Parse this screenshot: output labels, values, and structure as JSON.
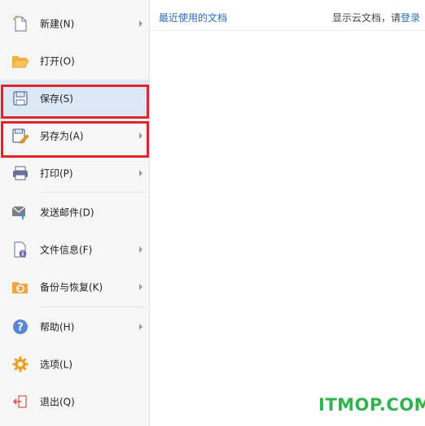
{
  "menu": {
    "items": [
      {
        "id": "new",
        "label": "新建(N)",
        "icon": "new-document-icon",
        "has_submenu": true
      },
      {
        "id": "open",
        "label": "打开(O)",
        "icon": "folder-open-icon",
        "has_submenu": false
      },
      {
        "id": "save",
        "label": "保存(S)",
        "icon": "save-icon",
        "has_submenu": false,
        "active": true
      },
      {
        "id": "save-as",
        "label": "另存为(A)",
        "icon": "save-as-icon",
        "has_submenu": true
      },
      {
        "id": "print",
        "label": "打印(P)",
        "icon": "printer-icon",
        "has_submenu": true
      },
      {
        "id": "send-email",
        "label": "发送邮件(D)",
        "icon": "email-icon",
        "has_submenu": false
      },
      {
        "id": "file-info",
        "label": "文件信息(F)",
        "icon": "file-info-icon",
        "has_submenu": true
      },
      {
        "id": "backup",
        "label": "备份与恢复(K)",
        "icon": "backup-restore-icon",
        "has_submenu": true
      },
      {
        "id": "help",
        "label": "帮助(H)",
        "icon": "help-icon",
        "has_submenu": true
      },
      {
        "id": "options",
        "label": "选项(L)",
        "icon": "gear-icon",
        "has_submenu": false
      },
      {
        "id": "exit",
        "label": "退出(Q)",
        "icon": "exit-icon",
        "has_submenu": false
      }
    ]
  },
  "recent": {
    "title": "最近使用的文档",
    "cloud_prompt": "显示云文档，请",
    "login_link": "登录"
  },
  "watermark": "ITMOP.COM",
  "colors": {
    "highlight_border": "#e2242b",
    "active_bg": "#dde8f6",
    "link": "#2f6fb5",
    "watermark": "#2fb34a"
  }
}
